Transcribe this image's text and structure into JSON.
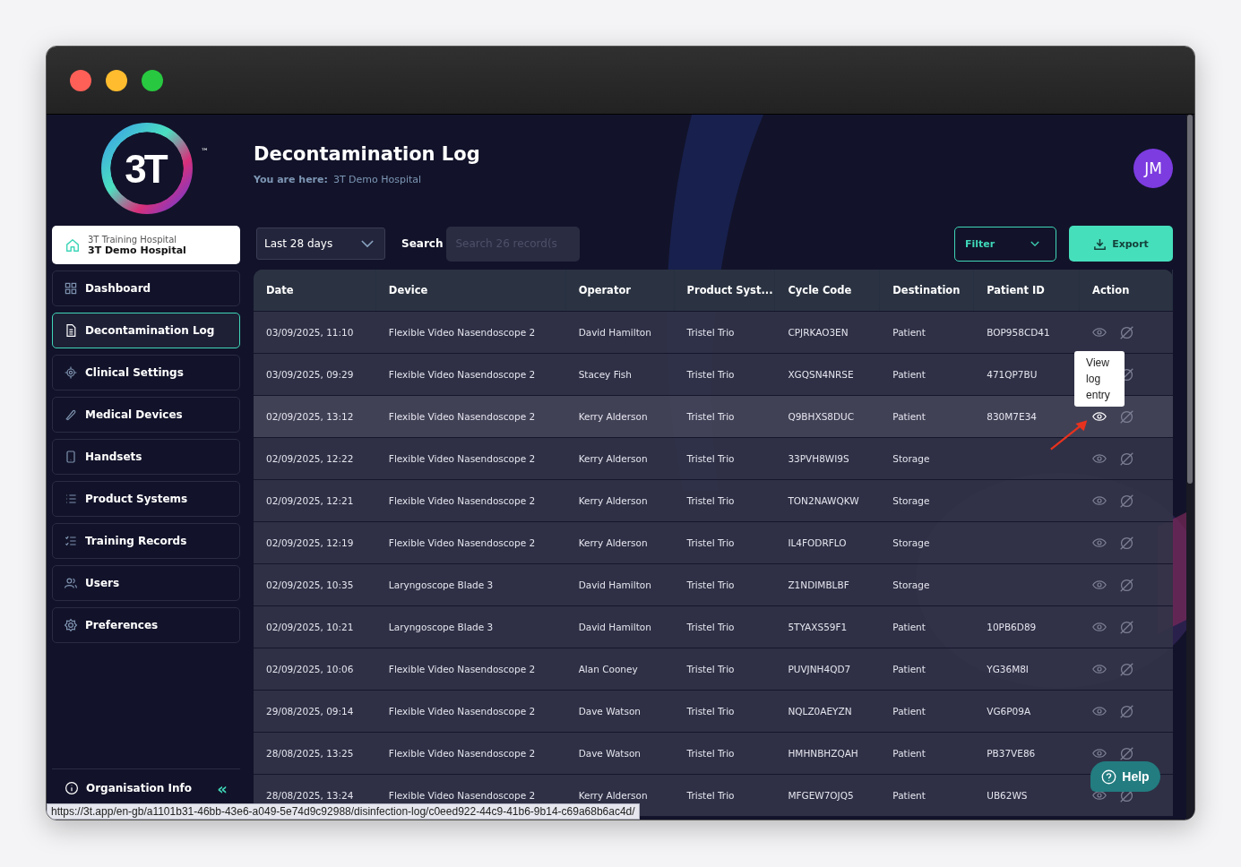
{
  "sidebar": {
    "logo": {
      "text": "3T",
      "mark": "™"
    },
    "organisation": {
      "group": "3T Training Hospital",
      "name": "3T Demo Hospital"
    },
    "items": [
      {
        "label": "Dashboard",
        "selected": false
      },
      {
        "label": "Decontamination Log",
        "selected": true
      },
      {
        "label": "Clinical Settings",
        "selected": false
      },
      {
        "label": "Medical Devices",
        "selected": false
      },
      {
        "label": "Handsets",
        "selected": false
      },
      {
        "label": "Product Systems",
        "selected": false
      },
      {
        "label": "Training Records",
        "selected": false
      },
      {
        "label": "Users",
        "selected": false
      },
      {
        "label": "Preferences",
        "selected": false
      }
    ],
    "footer": {
      "label": "Organisation Info",
      "collapse": "«"
    }
  },
  "header": {
    "title": "Decontamination Log",
    "breadcrumb_label": "You are here:",
    "breadcrumb": "3T Demo Hospital",
    "avatar": "JM"
  },
  "toolbar": {
    "period": "Last 28 days",
    "search_label": "Search",
    "search_placeholder": "Search 26 record(s",
    "filter": "Filter",
    "export": "Export"
  },
  "table": {
    "columns": [
      "Date",
      "Device",
      "Operator",
      "Product Syst...",
      "Cycle Code",
      "Destination",
      "Patient ID",
      "Action"
    ],
    "rows": [
      {
        "cells": [
          "03/09/2025, 11:10",
          "Flexible Video Nasendoscope 2",
          "David Hamilton",
          "Tristel Trio",
          "CPJRKAO3EN",
          "Patient",
          "BOP958CD41"
        ],
        "hovered": false
      },
      {
        "cells": [
          "03/09/2025, 09:29",
          "Flexible Video Nasendoscope 2",
          "Stacey Fish",
          "Tristel Trio",
          "XGQSN4NRSE",
          "Patient",
          "471QP7BU"
        ],
        "hovered": false
      },
      {
        "cells": [
          "02/09/2025, 13:12",
          "Flexible Video Nasendoscope 2",
          "Kerry Alderson",
          "Tristel Trio",
          "Q9BHXS8DUC",
          "Patient",
          "830M7E34"
        ],
        "hovered": true
      },
      {
        "cells": [
          "02/09/2025, 12:22",
          "Flexible Video Nasendoscope 2",
          "Kerry Alderson",
          "Tristel Trio",
          "33PVH8WI9S",
          "Storage",
          ""
        ],
        "hovered": false
      },
      {
        "cells": [
          "02/09/2025, 12:21",
          "Flexible Video Nasendoscope 2",
          "Kerry Alderson",
          "Tristel Trio",
          "TON2NAWQKW",
          "Storage",
          ""
        ],
        "hovered": false
      },
      {
        "cells": [
          "02/09/2025, 12:19",
          "Flexible Video Nasendoscope 2",
          "Kerry Alderson",
          "Tristel Trio",
          "IL4FODRFLO",
          "Storage",
          ""
        ],
        "hovered": false
      },
      {
        "cells": [
          "02/09/2025, 10:35",
          "Laryngoscope Blade 3",
          "David Hamilton",
          "Tristel Trio",
          "Z1NDIMBLBF",
          "Storage",
          ""
        ],
        "hovered": false
      },
      {
        "cells": [
          "02/09/2025, 10:21",
          "Laryngoscope Blade 3",
          "David Hamilton",
          "Tristel Trio",
          "5TYAXS59F1",
          "Patient",
          "10PB6D89"
        ],
        "hovered": false
      },
      {
        "cells": [
          "02/09/2025, 10:06",
          "Flexible Video Nasendoscope 2",
          "Alan Cooney",
          "Tristel Trio",
          "PUVJNH4QD7",
          "Patient",
          "YG36M8I"
        ],
        "hovered": false
      },
      {
        "cells": [
          "29/08/2025, 09:14",
          "Flexible Video Nasendoscope 2",
          "Dave Watson",
          "Tristel Trio",
          "NQLZ0AEYZN",
          "Patient",
          "VG6P09A"
        ],
        "hovered": false
      },
      {
        "cells": [
          "28/08/2025, 13:25",
          "Flexible Video Nasendoscope 2",
          "Dave Watson",
          "Tristel Trio",
          "HMHNBHZQAH",
          "Patient",
          "PB37VE86"
        ],
        "hovered": false
      },
      {
        "cells": [
          "28/08/2025, 13:24",
          "Flexible Video Nasendoscope 2",
          "Kerry Alderson",
          "Tristel Trio",
          "MFGEW7OJQ5",
          "Patient",
          "UB62WS"
        ],
        "hovered": false
      }
    ],
    "tooltip": "View log entry"
  },
  "help": "Help",
  "status_url": "https://3t.app/en-gb/a1101b31-46bb-43e6-a049-5e74d9c92988/disinfection-log/c0eed922-44c9-41b6-9b14-c69a68b6ac4d/"
}
